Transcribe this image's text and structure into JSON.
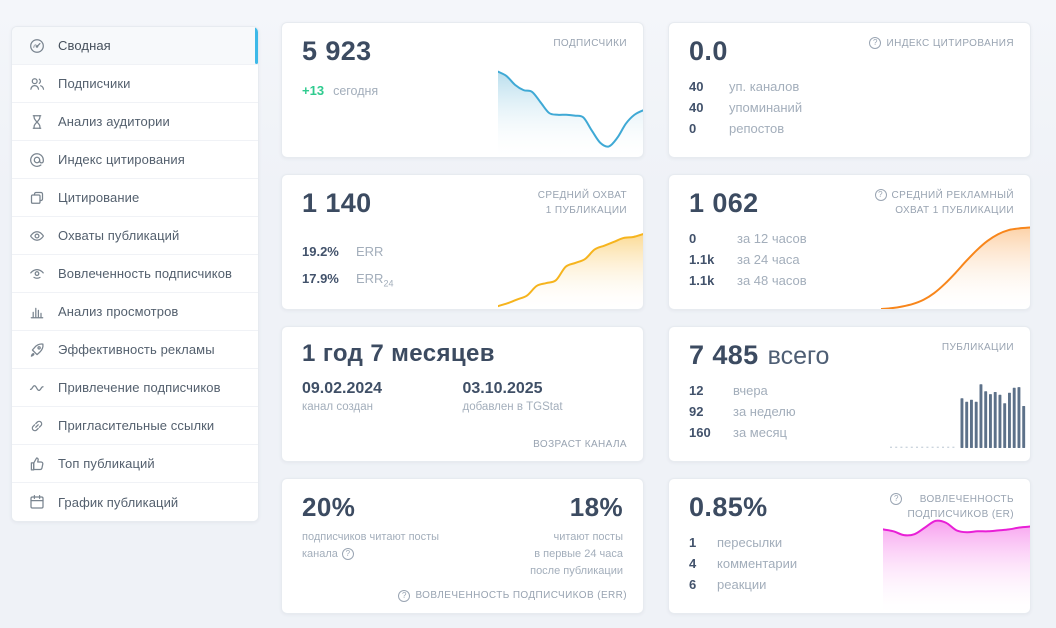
{
  "icons": {
    "help": "?"
  },
  "sidebar": {
    "active": "Сводная",
    "items": [
      {
        "label": "Сводная"
      },
      {
        "label": "Подписчики"
      },
      {
        "label": "Анализ аудитории"
      },
      {
        "label": "Индекс цитирования"
      },
      {
        "label": "Цитирование"
      },
      {
        "label": "Охваты публикаций"
      },
      {
        "label": "Вовлеченность подписчиков"
      },
      {
        "label": "Анализ просмотров"
      },
      {
        "label": "Эффективность рекламы"
      },
      {
        "label": "Привлечение подписчиков"
      },
      {
        "label": "Пригласительные ссылки"
      },
      {
        "label": "Топ публикаций"
      },
      {
        "label": "График публикаций"
      }
    ]
  },
  "cards": {
    "subscribers": {
      "value": "5 923",
      "label": "ПОДПИСЧИКИ",
      "delta": "+13",
      "delta_label": "сегодня"
    },
    "citation_index": {
      "value": "0.0",
      "label": "ИНДЕКС ЦИТИРОВАНИЯ",
      "stats": [
        {
          "value": "40",
          "label": "уп. каналов"
        },
        {
          "value": "40",
          "label": "упоминаний"
        },
        {
          "value": "0",
          "label": "репостов"
        }
      ]
    },
    "avg_reach": {
      "value": "1 140",
      "label_line1": "СРЕДНИЙ ОХВАТ",
      "label_line2": "1 ПУБЛИКАЦИИ",
      "stats": [
        {
          "value": "19.2%",
          "label": "ERR"
        },
        {
          "value": "17.9%",
          "label": "ERR",
          "label_sub": "24"
        }
      ]
    },
    "avg_ad_reach": {
      "value": "1 062",
      "label_line1": "СРЕДНИЙ РЕКЛАМНЫЙ",
      "label_line2": "ОХВАТ 1 ПУБЛИКАЦИИ",
      "stats": [
        {
          "value": "0",
          "label": "за 12 часов"
        },
        {
          "value": "1.1k",
          "label": "за 24 часа"
        },
        {
          "value": "1.1k",
          "label": "за 48 часов"
        }
      ]
    },
    "channel_age": {
      "value": "1 год 7 месяцев",
      "created_date": "09.02.2024",
      "created_label": "канал создан",
      "added_date": "03.10.2025",
      "added_label": "добавлен в TGStat",
      "footer": "ВОЗРАСТ КАНАЛА"
    },
    "publications": {
      "value": "7 485",
      "suffix": "всего",
      "label": "ПУБЛИКАЦИИ",
      "stats": [
        {
          "value": "12",
          "label": "вчера"
        },
        {
          "value": "92",
          "label": "за неделю"
        },
        {
          "value": "160",
          "label": "за месяц"
        }
      ]
    },
    "err": {
      "left_value": "20%",
      "left_label_line1": "подписчиков читают посты",
      "left_label_line2": "канала",
      "right_value": "18%",
      "right_label_line1": "читают посты",
      "right_label_line2": "в первые 24 часа",
      "right_label_line3": "после публикации",
      "footer": "ВОВЛЕЧЕННОСТЬ ПОДПИСЧИКОВ (ERR)"
    },
    "er": {
      "value": "0.85%",
      "label_line1": "ВОВЛЕЧЕННОСТЬ",
      "label_line2": "ПОДПИСЧИКОВ (ER)",
      "stats": [
        {
          "value": "1",
          "label": "пересылки"
        },
        {
          "value": "4",
          "label": "комментарии"
        },
        {
          "value": "6",
          "label": "реакции"
        }
      ]
    }
  },
  "chart_data": [
    {
      "id": "subscribers-trend",
      "type": "area",
      "title": "ПОДПИСЧИКИ sparkline",
      "color": "#3fa9d5",
      "fill_from": "#b5dcec",
      "values": [
        97,
        92,
        82,
        76,
        74,
        62,
        50,
        48,
        48,
        47,
        45,
        30,
        16,
        12,
        22,
        38,
        48,
        53
      ]
    },
    {
      "id": "avg-reach-trend",
      "type": "area",
      "title": "СРЕДНИЙ ОХВАТ 1 ПУБЛИКАЦИИ sparkline",
      "color": "#f6b41d",
      "fill_from": "#fbd88f",
      "values": [
        3,
        6,
        10,
        14,
        24,
        27,
        30,
        44,
        48,
        52,
        62,
        66,
        70,
        74,
        75,
        78
      ]
    },
    {
      "id": "ad-reach-curve",
      "type": "area",
      "title": "СРЕДНИЙ РЕКЛАМНЫЙ ОХВАТ 1 ПУБЛИКАЦИИ sparkline",
      "color": "#f8861b",
      "fill_from": "#fccfa3",
      "values": [
        0,
        1,
        3,
        6,
        11,
        19,
        30,
        43,
        57,
        70,
        81,
        89,
        94,
        96,
        97
      ]
    },
    {
      "id": "posts-histogram",
      "type": "bar",
      "title": "ПУБЛИКАЦИИ histogram",
      "color": "#5d7189",
      "axis_color": "#ccd5de",
      "values": [
        71,
        66,
        69,
        66,
        91,
        81,
        77,
        80,
        76,
        64,
        79,
        86,
        87,
        60
      ]
    },
    {
      "id": "er-trend",
      "type": "area",
      "title": "ВОВЛЕЧЕННОСТЬ ПОДПИСЧИКОВ (ER) sparkline",
      "color": "#e81fd6",
      "fill_from": "#f79aee",
      "values": [
        88,
        86,
        82,
        83,
        90,
        97,
        95,
        87,
        85,
        86,
        86,
        87,
        88,
        90,
        91
      ]
    }
  ]
}
